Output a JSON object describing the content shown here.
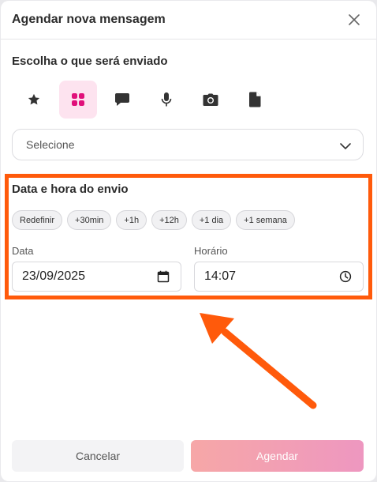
{
  "dialog": {
    "title": "Agendar nova mensagem",
    "close_icon": "close-icon"
  },
  "content_type": {
    "title": "Escolha o que será enviado",
    "options": [
      {
        "icon": "star-icon",
        "active": false
      },
      {
        "icon": "grid-icon",
        "active": true
      },
      {
        "icon": "chat-bubble-icon",
        "active": false
      },
      {
        "icon": "microphone-icon",
        "active": false
      },
      {
        "icon": "camera-icon",
        "active": false
      },
      {
        "icon": "document-icon",
        "active": false
      }
    ],
    "select": {
      "value": "Selecione",
      "icon": "chevron-down-icon"
    }
  },
  "schedule": {
    "title": "Data e hora do envio",
    "chips": [
      "Redefinir",
      "+30min",
      "+1h",
      "+12h",
      "+1 dia",
      "+1 semana"
    ],
    "date_label": "Data",
    "date_value": "23/09/2025",
    "time_label": "Horário",
    "time_value": "14:07"
  },
  "actions": {
    "cancel": "Cancelar",
    "submit": "Agendar"
  },
  "colors": {
    "accent_pink": "#e0107a",
    "active_bg": "#fde3ef",
    "annotation_orange": "#ff5a0b",
    "submit_gradient_start": "#f6a7a7",
    "submit_gradient_end": "#ee97c0"
  }
}
